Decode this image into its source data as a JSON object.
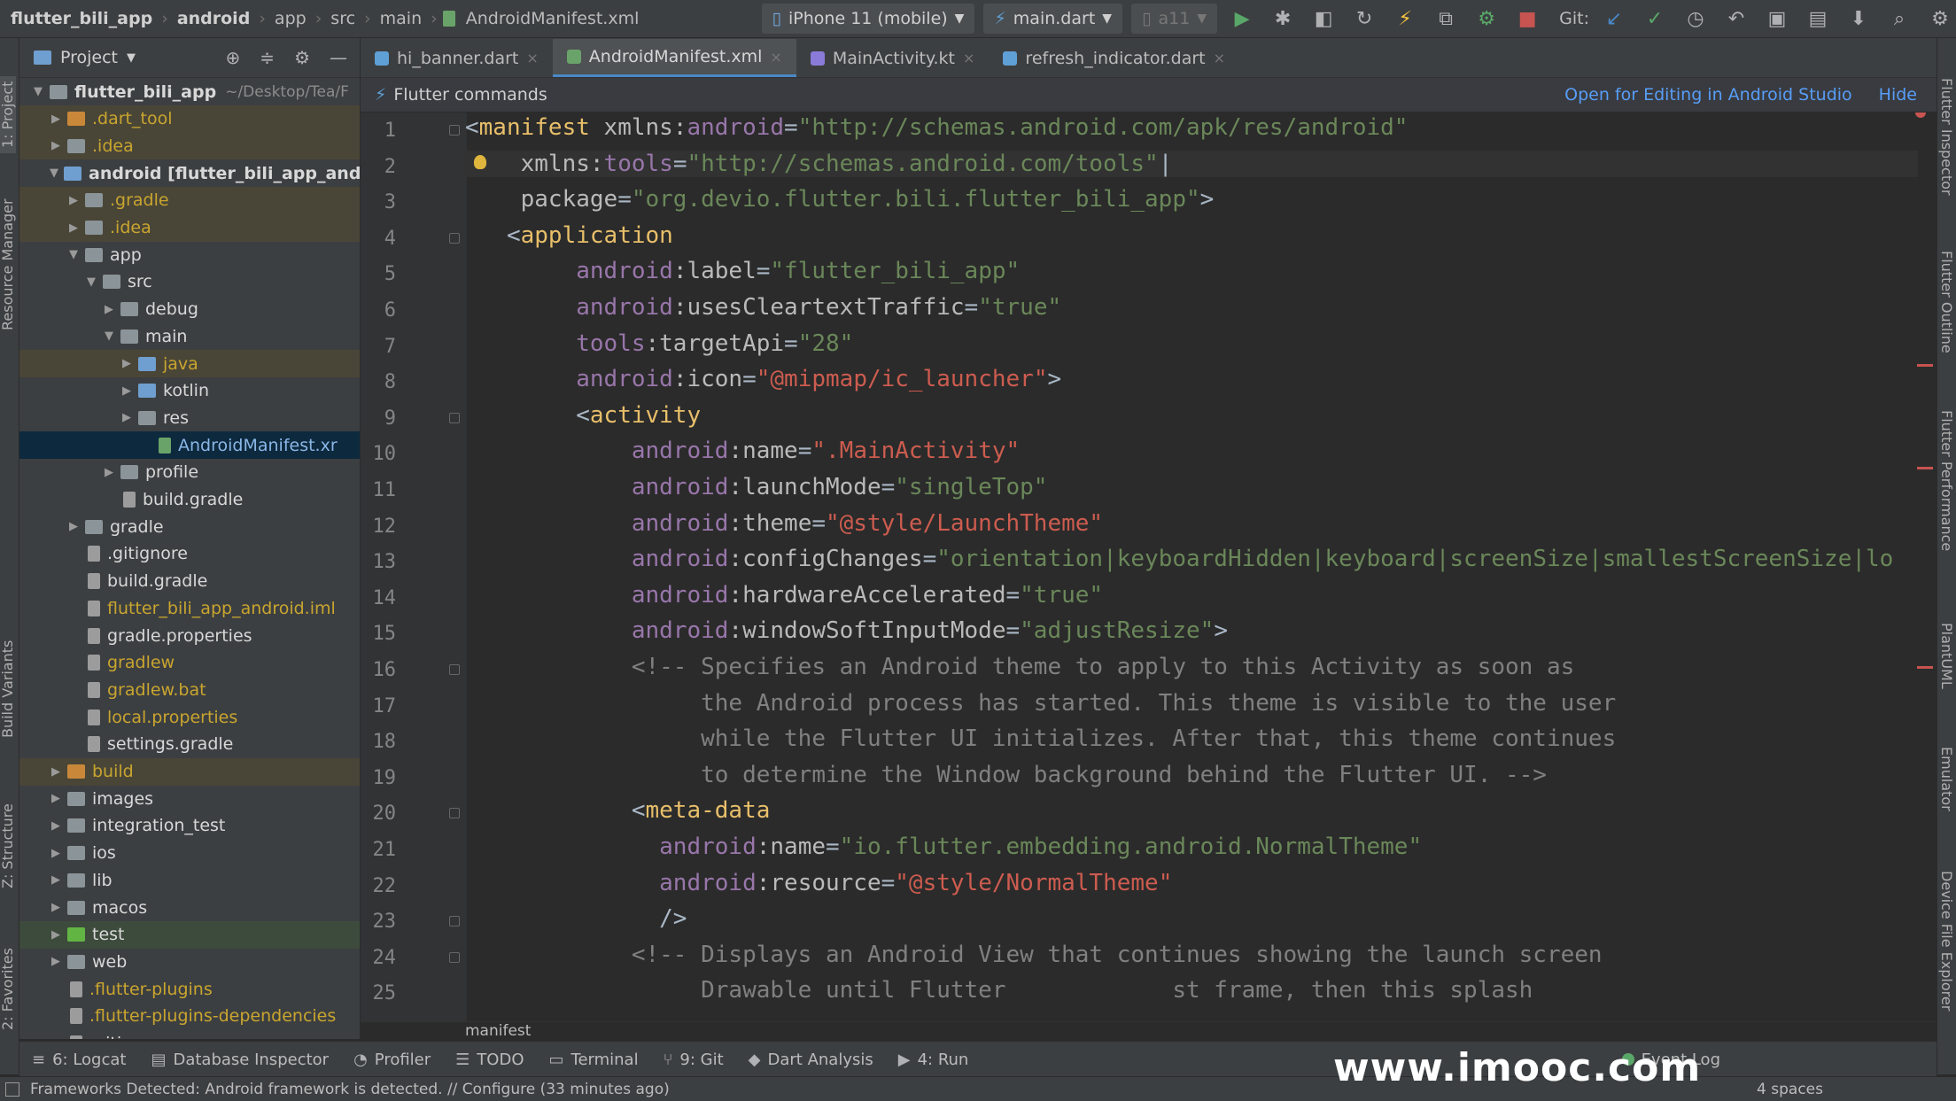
{
  "nav": {
    "crumbs": [
      "flutter_bili_app",
      "android",
      "app",
      "src",
      "main",
      "AndroidManifest.xml"
    ],
    "device": "iPhone 11 (mobile)",
    "run_config": "main.dart",
    "sdk": "a11",
    "git_label": "Git:"
  },
  "left_stripe": {
    "project": "1: Project",
    "resource_manager": "Resource Manager",
    "build_variants": "Build Variants",
    "structure": "Z: Structure",
    "favorites": "2: Favorites"
  },
  "right_stripe": {
    "flutter_inspector": "Flutter Inspector",
    "flutter_outline": "Flutter Outline",
    "flutter_performance": "Flutter Performance",
    "plantuml": "PlantUML",
    "emulator": "Emulator",
    "device_file_explorer": "Device File Explorer"
  },
  "project_panel": {
    "title": "Project",
    "rows": [
      {
        "label": "flutter_bili_app",
        "suffix": "~/Desktop/Tea/F",
        "depth": 0,
        "arrow": "▼",
        "icon": "folder",
        "color": "#d8d8d8",
        "bold": true
      },
      {
        "label": ".dart_tool",
        "depth": 1,
        "arrow": "▶",
        "icon": "folder-orange",
        "color": "#c9a52f"
      },
      {
        "label": ".idea",
        "depth": 1,
        "arrow": "▶",
        "icon": "folder",
        "color": "#c9a52f"
      },
      {
        "label": "android [flutter_bili_app_andr",
        "depth": 1,
        "arrow": "▼",
        "icon": "folder-blue",
        "color": "#d8d8d8",
        "bold": true
      },
      {
        "label": ".gradle",
        "depth": 2,
        "arrow": "▶",
        "icon": "folder",
        "color": "#c9a52f"
      },
      {
        "label": ".idea",
        "depth": 2,
        "arrow": "▶",
        "icon": "folder",
        "color": "#c9a52f"
      },
      {
        "label": "app",
        "depth": 2,
        "arrow": "▼",
        "icon": "folder",
        "color": "#d8d8d8"
      },
      {
        "label": "src",
        "depth": 3,
        "arrow": "▼",
        "icon": "folder",
        "color": "#d8d8d8"
      },
      {
        "label": "debug",
        "depth": 4,
        "arrow": "▶",
        "icon": "folder",
        "color": "#d8d8d8"
      },
      {
        "label": "main",
        "depth": 4,
        "arrow": "▼",
        "icon": "folder",
        "color": "#d8d8d8"
      },
      {
        "label": "java",
        "depth": 5,
        "arrow": "▶",
        "icon": "folder-blue",
        "color": "#c9a52f"
      },
      {
        "label": "kotlin",
        "depth": 5,
        "arrow": "▶",
        "icon": "folder-blue",
        "color": "#d8d8d8"
      },
      {
        "label": "res",
        "depth": 5,
        "arrow": "▶",
        "icon": "folder",
        "color": "#d8d8d8"
      },
      {
        "label": "AndroidManifest.xr",
        "depth": 6,
        "arrow": "",
        "icon": "file-manifest",
        "color": "#8ab6e6",
        "selected": true
      },
      {
        "label": "profile",
        "depth": 4,
        "arrow": "▶",
        "icon": "folder",
        "color": "#d8d8d8"
      },
      {
        "label": "build.gradle",
        "depth": 4,
        "arrow": "",
        "icon": "file",
        "color": "#d8d8d8"
      },
      {
        "label": "gradle",
        "depth": 2,
        "arrow": "▶",
        "icon": "folder",
        "color": "#d8d8d8"
      },
      {
        "label": ".gitignore",
        "depth": 2,
        "arrow": "",
        "icon": "file",
        "color": "#d8d8d8"
      },
      {
        "label": "build.gradle",
        "depth": 2,
        "arrow": "",
        "icon": "file",
        "color": "#d8d8d8"
      },
      {
        "label": "flutter_bili_app_android.iml",
        "depth": 2,
        "arrow": "",
        "icon": "file",
        "color": "#c9a52f"
      },
      {
        "label": "gradle.properties",
        "depth": 2,
        "arrow": "",
        "icon": "file",
        "color": "#d8d8d8"
      },
      {
        "label": "gradlew",
        "depth": 2,
        "arrow": "",
        "icon": "file",
        "color": "#c9a52f"
      },
      {
        "label": "gradlew.bat",
        "depth": 2,
        "arrow": "",
        "icon": "file",
        "color": "#c9a52f"
      },
      {
        "label": "local.properties",
        "depth": 2,
        "arrow": "",
        "icon": "file",
        "color": "#c9a52f"
      },
      {
        "label": "settings.gradle",
        "depth": 2,
        "arrow": "",
        "icon": "file",
        "color": "#d8d8d8"
      },
      {
        "label": "build",
        "depth": 1,
        "arrow": "▶",
        "icon": "folder-orange",
        "color": "#c9a52f"
      },
      {
        "label": "images",
        "depth": 1,
        "arrow": "▶",
        "icon": "folder",
        "color": "#d8d8d8"
      },
      {
        "label": "integration_test",
        "depth": 1,
        "arrow": "▶",
        "icon": "folder",
        "color": "#d8d8d8"
      },
      {
        "label": "ios",
        "depth": 1,
        "arrow": "▶",
        "icon": "folder",
        "color": "#d8d8d8"
      },
      {
        "label": "lib",
        "depth": 1,
        "arrow": "▶",
        "icon": "folder",
        "color": "#d8d8d8"
      },
      {
        "label": "macos",
        "depth": 1,
        "arrow": "▶",
        "icon": "folder",
        "color": "#d8d8d8"
      },
      {
        "label": "test",
        "depth": 1,
        "arrow": "▶",
        "icon": "folder-green",
        "color": "#d8d8d8"
      },
      {
        "label": "web",
        "depth": 1,
        "arrow": "▶",
        "icon": "folder",
        "color": "#d8d8d8"
      },
      {
        "label": ".flutter-plugins",
        "depth": 1,
        "arrow": "",
        "icon": "file",
        "color": "#c9a52f"
      },
      {
        "label": ".flutter-plugins-dependencies",
        "depth": 1,
        "arrow": "",
        "icon": "file",
        "color": "#c9a52f"
      },
      {
        "label": ".gitignore",
        "depth": 1,
        "arrow": "",
        "icon": "file",
        "color": "#d8d8d8"
      }
    ]
  },
  "tabs": [
    {
      "label": "hi_banner.dart",
      "active": false
    },
    {
      "label": "AndroidManifest.xml",
      "active": true
    },
    {
      "label": "MainActivity.kt",
      "active": false
    },
    {
      "label": "refresh_indicator.dart",
      "active": false
    }
  ],
  "flutter_commands": {
    "title": "Flutter commands",
    "open_link": "Open for Editing in Android Studio",
    "hide": "Hide"
  },
  "code_lines": [
    [
      [
        "ab",
        "<"
      ],
      [
        "tg",
        "manifest"
      ],
      [
        "at",
        " xmlns:"
      ],
      [
        "ns",
        "android"
      ],
      [
        "ab",
        "="
      ],
      [
        "st",
        "\"http://schemas.android.com/apk/res/android\""
      ]
    ],
    [
      [
        "at",
        "    xmlns:"
      ],
      [
        "ns",
        "tools"
      ],
      [
        "ab",
        "="
      ],
      [
        "st",
        "\"http://schemas.android.com/tools\""
      ],
      [
        "ab",
        "|"
      ]
    ],
    [
      [
        "at",
        "    package"
      ],
      [
        "ab",
        "="
      ],
      [
        "st",
        "\"org.devio.flutter.bili.flutter_bili_app\""
      ],
      [
        "ab",
        ">"
      ]
    ],
    [
      [
        "ab",
        "   <"
      ],
      [
        "tg",
        "application"
      ]
    ],
    [
      [
        "ns",
        "        android"
      ],
      [
        "at",
        ":label"
      ],
      [
        "ab",
        "="
      ],
      [
        "st",
        "\"flutter_bili_app\""
      ]
    ],
    [
      [
        "ns",
        "        android"
      ],
      [
        "at",
        ":usesCleartextTraffic"
      ],
      [
        "ab",
        "="
      ],
      [
        "st",
        "\"true\""
      ]
    ],
    [
      [
        "ns",
        "        tools"
      ],
      [
        "at",
        ":targetApi"
      ],
      [
        "ab",
        "="
      ],
      [
        "st",
        "\"28\""
      ]
    ],
    [
      [
        "ns",
        "        android"
      ],
      [
        "at",
        ":icon"
      ],
      [
        "ab",
        "="
      ],
      [
        "rf",
        "\"@mipmap/ic_launcher\""
      ],
      [
        "ab",
        ">"
      ]
    ],
    [
      [
        "ab",
        "        <"
      ],
      [
        "tg",
        "activity"
      ]
    ],
    [
      [
        "ns",
        "            android"
      ],
      [
        "at",
        ":name"
      ],
      [
        "ab",
        "="
      ],
      [
        "rf",
        "\".MainActivity\""
      ]
    ],
    [
      [
        "ns",
        "            android"
      ],
      [
        "at",
        ":launchMode"
      ],
      [
        "ab",
        "="
      ],
      [
        "st",
        "\"singleTop\""
      ]
    ],
    [
      [
        "ns",
        "            android"
      ],
      [
        "at",
        ":theme"
      ],
      [
        "ab",
        "="
      ],
      [
        "rf",
        "\"@style/LaunchTheme\""
      ]
    ],
    [
      [
        "ns",
        "            android"
      ],
      [
        "at",
        ":configChanges"
      ],
      [
        "ab",
        "="
      ],
      [
        "st",
        "\"orientation|keyboardHidden|keyboard|screenSize|smallestScreenSize|lo"
      ]
    ],
    [
      [
        "ns",
        "            android"
      ],
      [
        "at",
        ":hardwareAccelerated"
      ],
      [
        "ab",
        "="
      ],
      [
        "st",
        "\"true\""
      ]
    ],
    [
      [
        "ns",
        "            android"
      ],
      [
        "at",
        ":windowSoftInputMode"
      ],
      [
        "ab",
        "="
      ],
      [
        "st",
        "\"adjustResize\""
      ],
      [
        "ab",
        ">"
      ]
    ],
    [
      [
        "cm",
        "            <!-- Specifies an Android theme to apply to this Activity as soon as"
      ]
    ],
    [
      [
        "cm",
        "                 the Android process has started. This theme is visible to the user"
      ]
    ],
    [
      [
        "cm",
        "                 while the Flutter UI initializes. After that, this theme continues"
      ]
    ],
    [
      [
        "cm",
        "                 to determine the Window background behind the Flutter UI. -->"
      ]
    ],
    [
      [
        "ab",
        "            <"
      ],
      [
        "tg",
        "meta-data"
      ]
    ],
    [
      [
        "ns",
        "              android"
      ],
      [
        "at",
        ":name"
      ],
      [
        "ab",
        "="
      ],
      [
        "st",
        "\"io.flutter.embedding.android.NormalTheme\""
      ]
    ],
    [
      [
        "ns",
        "              android"
      ],
      [
        "at",
        ":resource"
      ],
      [
        "ab",
        "="
      ],
      [
        "rf",
        "\"@style/NormalTheme\""
      ]
    ],
    [
      [
        "ab",
        "              />"
      ]
    ],
    [
      [
        "cm",
        "            <!-- Displays an Android View that continues showing the launch screen"
      ]
    ],
    [
      [
        "cm",
        "                 Drawable until Flutter            st frame, then this splash"
      ]
    ]
  ],
  "line_numbers": [
    "1",
    "2",
    "3",
    "4",
    "5",
    "6",
    "7",
    "8",
    "9",
    "10",
    "11",
    "12",
    "13",
    "14",
    "15",
    "16",
    "17",
    "18",
    "19",
    "20",
    "21",
    "22",
    "23",
    "24",
    "25"
  ],
  "editor_breadcrumb": "manifest",
  "bottom_tabs": [
    {
      "label": "6: Logcat",
      "icon": "≡"
    },
    {
      "label": "Database Inspector",
      "icon": "▤"
    },
    {
      "label": "Profiler",
      "icon": "◔"
    },
    {
      "label": "TODO",
      "icon": "☰"
    },
    {
      "label": "Terminal",
      "icon": "▭"
    },
    {
      "label": "9: Git",
      "icon": "⑂"
    },
    {
      "label": "Dart Analysis",
      "icon": "◆"
    },
    {
      "label": "4: Run",
      "icon": "▶"
    }
  ],
  "event_log": "Event Log",
  "status": {
    "message": "Frameworks Detected: Android framework is detected. // Configure (33 minutes ago)",
    "indent": "4 spaces"
  },
  "watermark": "www.imooc.com",
  "colors": {
    "accent": "#4a88c7",
    "tag": "#e8bf6a",
    "namespace": "#9876aa",
    "string": "#6a8759",
    "resource": "#cc5c4f",
    "comment": "#808080"
  }
}
